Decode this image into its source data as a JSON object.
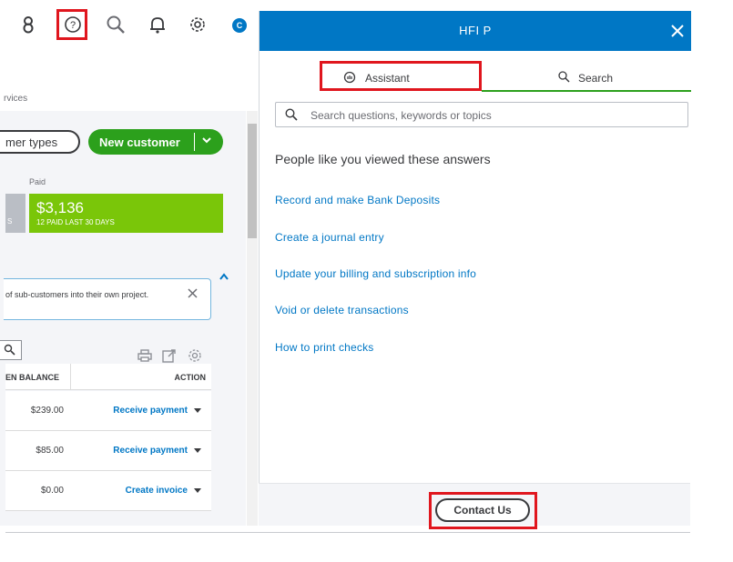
{
  "toolbar": {
    "icons": [
      "user-icon",
      "help-icon",
      "search-icon",
      "bell-icon",
      "gear-icon"
    ],
    "avatar_letter": "C"
  },
  "left": {
    "breadcrumb_fragment": "rvices",
    "customer_types_label": "mer types",
    "new_customer_label": "New customer",
    "paid_label": "Paid",
    "grey_tile_fragment": "S",
    "paid_amount": "$3,136",
    "paid_caption": "12 PAID LAST 30 DAYS",
    "notice_text": "of sub-customers into their own project.",
    "table": {
      "col_balance": "EN BALANCE",
      "col_action": "ACTION",
      "rows": [
        {
          "balance": "$239.00",
          "action": "Receive payment"
        },
        {
          "balance": "$85.00",
          "action": "Receive payment"
        },
        {
          "balance": "$0.00",
          "action": "Create invoice"
        }
      ]
    }
  },
  "help": {
    "title": "HFI P",
    "tabs": [
      {
        "label": "Assistant"
      },
      {
        "label": "Search"
      }
    ],
    "search_placeholder": "Search questions, keywords or topics",
    "section_heading": "People like you viewed these answers",
    "links": [
      "Record and make Bank Deposits",
      "Create a journal entry",
      "Update your billing and subscription info",
      "Void or delete transactions",
      "How to print checks"
    ],
    "contact_label": "Contact Us"
  },
  "colors": {
    "brand_blue": "#0077c5",
    "green": "#2ca01c",
    "paid_green": "#7ac609",
    "highlight_red": "#e0161e"
  }
}
